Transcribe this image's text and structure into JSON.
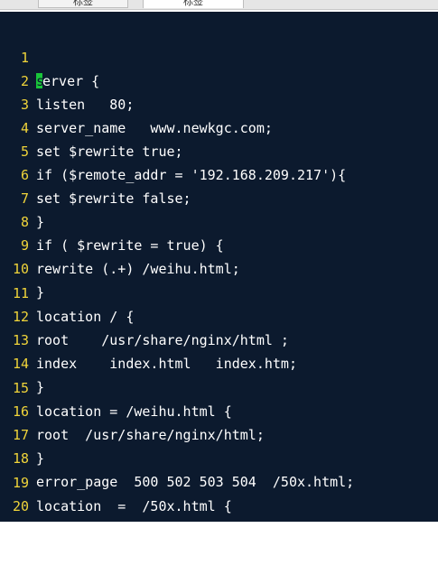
{
  "tabs": [
    "标签",
    "标签"
  ],
  "editor": {
    "cursor_color": "#19c53a",
    "line_number_color": "#f0d43a",
    "background_color": "#0c1a2e",
    "lines": [
      {
        "num": "1",
        "text": "erver {",
        "first_char": "s"
      },
      {
        "num": "2",
        "text": "listen   80;"
      },
      {
        "num": "3",
        "text": "server_name   www.newkgc.com;"
      },
      {
        "num": "4",
        "text": "set $rewrite true;"
      },
      {
        "num": "5",
        "text": "if ($remote_addr = '192.168.209.217'){"
      },
      {
        "num": "6",
        "text": "set $rewrite false;"
      },
      {
        "num": "7",
        "text": "}"
      },
      {
        "num": "8",
        "text": "if ( $rewrite = true) {"
      },
      {
        "num": "9",
        "text": "rewrite (.+) /weihu.html;"
      },
      {
        "num": "10",
        "text": "}"
      },
      {
        "num": "11",
        "text": "location / {"
      },
      {
        "num": "12",
        "text": "root    /usr/share/nginx/html ;"
      },
      {
        "num": "13",
        "text": "index    index.html   index.htm;"
      },
      {
        "num": "14",
        "text": "}"
      },
      {
        "num": "15",
        "text": "location = /weihu.html {"
      },
      {
        "num": "16",
        "text": "root  /usr/share/nginx/html;"
      },
      {
        "num": "17",
        "text": "}"
      },
      {
        "num": "18",
        "text": "error_page  500 502 503 504  /50x.html;"
      },
      {
        "num": "19",
        "text": "location  =  /50x.html {"
      },
      {
        "num": "20",
        "text": "root  /usr/share/nginx/html;"
      }
    ]
  }
}
